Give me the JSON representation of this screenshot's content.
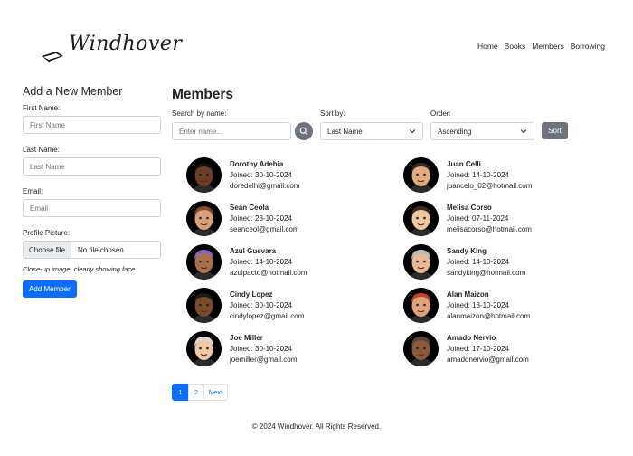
{
  "header": {
    "logo_text": "Windhover",
    "nav": [
      "Home",
      "Books",
      "Members",
      "Borrowing"
    ]
  },
  "form": {
    "title": "Add a New Member",
    "first_name_label": "First Name:",
    "first_name_placeholder": "First Name",
    "last_name_label": "Last Name:",
    "last_name_placeholder": "Last Name",
    "email_label": "Email:",
    "email_placeholder": "Email",
    "picture_label": "Profile Picture:",
    "choose_file": "Choose file",
    "no_file": "No file chosen",
    "hint": "Close-up image, clearly showing face",
    "submit": "Add Member"
  },
  "main": {
    "title": "Members",
    "search_label": "Search by name:",
    "search_placeholder": "Enter name...",
    "sort_label": "Sort by:",
    "sort_value": "Last Name",
    "order_label": "Order:",
    "order_value": "Ascending",
    "sort_button": "Sort"
  },
  "members": [
    {
      "name": "Dorothy Adehia",
      "joined": "Joined: 30-10-2024",
      "email": "doredelhi@gmail.com",
      "skin": "#6b3e26",
      "hair": "#111111",
      "bg": "#000000"
    },
    {
      "name": "Juan Celli",
      "joined": "Joined: 14-10-2024",
      "email": "juancelo_02@hotmail.com",
      "skin": "#e0ac7e",
      "hair": "#3b2a1e",
      "bg": "#000000"
    },
    {
      "name": "Sean Ceola",
      "joined": "Joined: 23-10-2024",
      "email": "seanceol@gmail.com",
      "skin": "#d9a07a",
      "hair": "#7a4a2a",
      "bg": "#000000"
    },
    {
      "name": "Melisa Corso",
      "joined": "Joined: 07-11-2024",
      "email": "melisacorso@hotmail.com",
      "skin": "#f0c7a0",
      "hair": "#3a2a20",
      "bg": "#000000"
    },
    {
      "name": "Azul Guevara",
      "joined": "Joined: 14-10-2024",
      "email": "azulpacto@hotmail.com",
      "skin": "#a8714c",
      "hair": "#8e5fc8",
      "bg": "#000000"
    },
    {
      "name": "Sandy King",
      "joined": "Joined: 14-10-2024",
      "email": "sandyking@hotmail.com",
      "skin": "#e8b894",
      "hair": "#b8b8b8",
      "bg": "#000000"
    },
    {
      "name": "Cindy Lopez",
      "joined": "Joined: 30-10-2024",
      "email": "cindylopez@gmail.com",
      "skin": "#7a4a2c",
      "hair": "#1a1a1a",
      "bg": "#000000"
    },
    {
      "name": "Alan Maizon",
      "joined": "Joined: 13-10-2024",
      "email": "alanmaizon@hotmail.com",
      "skin": "#e0a47c",
      "hair": "#c8402a",
      "bg": "#000000"
    },
    {
      "name": "Joe Miller",
      "joined": "Joined: 30-10-2024",
      "email": "joemiller@gmail.com",
      "skin": "#f0c8a8",
      "hair": "#d8d8d8",
      "bg": "#000000"
    },
    {
      "name": "Amado Nervio",
      "joined": "Joined: 17-10-2024",
      "email": "amadonervio@gmail.com",
      "skin": "#8a5a3a",
      "hair": "#5a4630",
      "bg": "#000000"
    }
  ],
  "pagination": {
    "pages": [
      "1",
      "2"
    ],
    "current": "1",
    "next": "Next"
  },
  "footer": "© 2024 Windhover. All Rights Reserved.",
  "colors": {
    "primary": "#0d6efd",
    "secondary": "#6c757d"
  }
}
